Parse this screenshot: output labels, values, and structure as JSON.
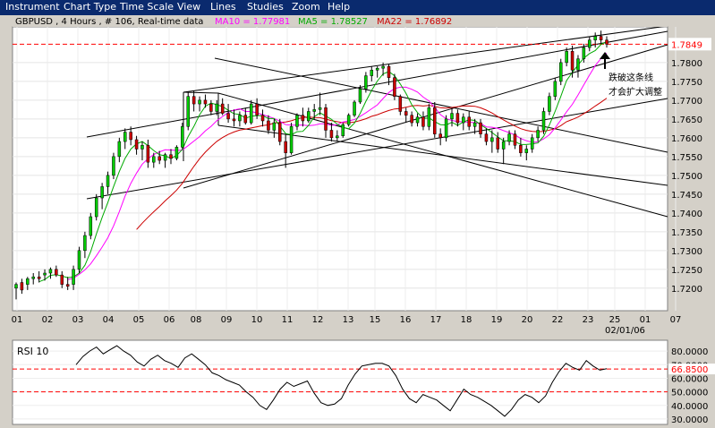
{
  "menu": [
    {
      "label": "Instrument"
    },
    {
      "label": "Chart Type"
    },
    {
      "label": "Time Scale"
    },
    {
      "label": "View"
    },
    {
      "label": "Lines"
    },
    {
      "label": "Studies"
    },
    {
      "label": "Zoom"
    },
    {
      "label": "Help"
    }
  ],
  "header": {
    "instrument_info": "GBPUSD , 4 Hours , # 106, Real-time data",
    "ma10_text": "MA10 = 1.77981",
    "ma5_text": "MA5 = 1.78527",
    "ma22_text": "MA22 = 1.76892"
  },
  "annotation": {
    "line1": "跌破这条线",
    "line2": "才会扩大调整"
  },
  "colors": {
    "background": "#ffffff",
    "frame": "#d4d0c8",
    "menubar": "#0a2a6e",
    "up_candle": "#00cc00",
    "down_candle": "#cc0000",
    "ma10": "#ff00ff",
    "ma5": "#00aa00",
    "ma22": "#cc0000",
    "reference_line": "#ff0000",
    "trend_lines": "#000000",
    "rsi_line": "#000000"
  },
  "chart_data": [
    {
      "type": "candlestick",
      "title": "GBPUSD , 4 Hours , # 106, Real-time data",
      "ylim": [
        1.714,
        1.7895
      ],
      "y_ticks": [
        "1.7200",
        "1.7250",
        "1.7300",
        "1.7350",
        "1.7400",
        "1.7450",
        "1.7500",
        "1.7550",
        "1.7600",
        "1.7650",
        "1.7700",
        "1.7750",
        "1.7800"
      ],
      "x_ticks": [
        "01",
        "02",
        "03",
        "04",
        "05",
        "06",
        "08",
        "09",
        "10",
        "11",
        "12",
        "13",
        "15",
        "16",
        "17",
        "18",
        "19",
        "20",
        "22",
        "23",
        "25",
        "01",
        "07"
      ],
      "date_label": "02/01/06",
      "current_price_label": "1.7849",
      "current_price": 1.7849,
      "grid": true,
      "series": [
        {
          "name": "MA10",
          "value": 1.77981
        },
        {
          "name": "MA5",
          "value": 1.78527
        },
        {
          "name": "MA22",
          "value": 1.76892
        }
      ],
      "candles": [
        [
          1.72,
          1.7215,
          1.717,
          1.721
        ],
        [
          1.7215,
          1.7225,
          1.7185,
          1.7195
        ],
        [
          1.721,
          1.723,
          1.7195,
          1.7225
        ],
        [
          1.7225,
          1.724,
          1.721,
          1.723
        ],
        [
          1.723,
          1.7245,
          1.7215,
          1.7225
        ],
        [
          1.7235,
          1.725,
          1.722,
          1.724
        ],
        [
          1.724,
          1.7255,
          1.7225,
          1.725
        ],
        [
          1.725,
          1.726,
          1.723,
          1.7235
        ],
        [
          1.7235,
          1.7245,
          1.72,
          1.721
        ],
        [
          1.721,
          1.723,
          1.7195,
          1.7205
        ],
        [
          1.721,
          1.726,
          1.7195,
          1.725
        ],
        [
          1.725,
          1.731,
          1.724,
          1.73
        ],
        [
          1.73,
          1.735,
          1.728,
          1.734
        ],
        [
          1.734,
          1.74,
          1.733,
          1.739
        ],
        [
          1.739,
          1.745,
          1.738,
          1.744
        ],
        [
          1.744,
          1.748,
          1.741,
          1.747
        ],
        [
          1.747,
          1.751,
          1.745,
          1.75
        ],
        [
          1.75,
          1.756,
          1.749,
          1.755
        ],
        [
          1.755,
          1.76,
          1.7535,
          1.759
        ],
        [
          1.759,
          1.7625,
          1.757,
          1.7615
        ],
        [
          1.7615,
          1.763,
          1.758,
          1.7595
        ],
        [
          1.7595,
          1.7605,
          1.7555,
          1.757
        ],
        [
          1.757,
          1.759,
          1.754,
          1.758
        ],
        [
          1.758,
          1.7595,
          1.752,
          1.7535
        ],
        [
          1.7535,
          1.756,
          1.752,
          1.755
        ],
        [
          1.755,
          1.7565,
          1.753,
          1.754
        ],
        [
          1.754,
          1.756,
          1.752,
          1.7555
        ],
        [
          1.7555,
          1.757,
          1.753,
          1.7545
        ],
        [
          1.7545,
          1.758,
          1.754,
          1.7575
        ],
        [
          1.7575,
          1.764,
          1.757,
          1.763
        ],
        [
          1.763,
          1.772,
          1.762,
          1.771
        ],
        [
          1.771,
          1.7725,
          1.767,
          1.769
        ],
        [
          1.769,
          1.771,
          1.767,
          1.77
        ],
        [
          1.77,
          1.7715,
          1.768,
          1.769
        ],
        [
          1.769,
          1.77,
          1.766,
          1.767
        ],
        [
          1.767,
          1.77,
          1.766,
          1.769
        ],
        [
          1.769,
          1.7705,
          1.766,
          1.7665
        ],
        [
          1.7665,
          1.769,
          1.764,
          1.765
        ],
        [
          1.765,
          1.7675,
          1.763,
          1.7645
        ],
        [
          1.7645,
          1.767,
          1.763,
          1.766
        ],
        [
          1.766,
          1.768,
          1.7635,
          1.764
        ],
        [
          1.764,
          1.77,
          1.7635,
          1.769
        ],
        [
          1.769,
          1.7705,
          1.765,
          1.766
        ],
        [
          1.766,
          1.7675,
          1.763,
          1.7645
        ],
        [
          1.7645,
          1.766,
          1.761,
          1.762
        ],
        [
          1.762,
          1.765,
          1.76,
          1.764
        ],
        [
          1.764,
          1.765,
          1.758,
          1.759
        ],
        [
          1.759,
          1.761,
          1.752,
          1.756
        ],
        [
          1.756,
          1.764,
          1.7555,
          1.763
        ],
        [
          1.763,
          1.7665,
          1.762,
          1.766
        ],
        [
          1.766,
          1.768,
          1.763,
          1.7645
        ],
        [
          1.7645,
          1.768,
          1.764,
          1.767
        ],
        [
          1.767,
          1.769,
          1.765,
          1.7675
        ],
        [
          1.7675,
          1.772,
          1.766,
          1.768
        ],
        [
          1.768,
          1.769,
          1.76,
          1.762
        ],
        [
          1.762,
          1.764,
          1.759,
          1.76
        ],
        [
          1.76,
          1.762,
          1.759,
          1.7605
        ],
        [
          1.7605,
          1.764,
          1.76,
          1.7635
        ],
        [
          1.7635,
          1.7665,
          1.763,
          1.766
        ],
        [
          1.766,
          1.77,
          1.7655,
          1.7695
        ],
        [
          1.7695,
          1.774,
          1.769,
          1.773
        ],
        [
          1.773,
          1.7775,
          1.772,
          1.7765
        ],
        [
          1.7765,
          1.779,
          1.775,
          1.778
        ],
        [
          1.778,
          1.779,
          1.776,
          1.7785
        ],
        [
          1.7785,
          1.78,
          1.7765,
          1.779
        ],
        [
          1.779,
          1.7795,
          1.774,
          1.776
        ],
        [
          1.776,
          1.777,
          1.77,
          1.771
        ],
        [
          1.771,
          1.7715,
          1.766,
          1.767
        ],
        [
          1.767,
          1.768,
          1.764,
          1.766
        ],
        [
          1.766,
          1.767,
          1.763,
          1.764
        ],
        [
          1.764,
          1.7665,
          1.763,
          1.7655
        ],
        [
          1.7655,
          1.767,
          1.762,
          1.763
        ],
        [
          1.763,
          1.769,
          1.762,
          1.768
        ],
        [
          1.768,
          1.7695,
          1.76,
          1.761
        ],
        [
          1.761,
          1.7625,
          1.758,
          1.76
        ],
        [
          1.76,
          1.766,
          1.759,
          1.765
        ],
        [
          1.765,
          1.768,
          1.763,
          1.7665
        ],
        [
          1.7665,
          1.7675,
          1.763,
          1.764
        ],
        [
          1.764,
          1.7665,
          1.762,
          1.7655
        ],
        [
          1.7655,
          1.767,
          1.762,
          1.763
        ],
        [
          1.763,
          1.765,
          1.761,
          1.764
        ],
        [
          1.764,
          1.765,
          1.76,
          1.761
        ],
        [
          1.761,
          1.7625,
          1.758,
          1.759
        ],
        [
          1.759,
          1.762,
          1.756,
          1.76
        ],
        [
          1.76,
          1.7615,
          1.756,
          1.757
        ],
        [
          1.757,
          1.76,
          1.753,
          1.759
        ],
        [
          1.759,
          1.762,
          1.758,
          1.761
        ],
        [
          1.761,
          1.762,
          1.757,
          1.758
        ],
        [
          1.758,
          1.76,
          1.755,
          1.756
        ],
        [
          1.756,
          1.758,
          1.754,
          1.757
        ],
        [
          1.757,
          1.761,
          1.756,
          1.76
        ],
        [
          1.76,
          1.763,
          1.759,
          1.762
        ],
        [
          1.762,
          1.768,
          1.761,
          1.767
        ],
        [
          1.767,
          1.772,
          1.766,
          1.771
        ],
        [
          1.771,
          1.776,
          1.77,
          1.775
        ],
        [
          1.775,
          1.781,
          1.774,
          1.78
        ],
        [
          1.78,
          1.784,
          1.779,
          1.783
        ],
        [
          1.783,
          1.7845,
          1.776,
          1.778
        ],
        [
          1.778,
          1.782,
          1.776,
          1.781
        ],
        [
          1.781,
          1.785,
          1.78,
          1.784
        ],
        [
          1.784,
          1.787,
          1.783,
          1.786
        ],
        [
          1.786,
          1.788,
          1.784,
          1.787
        ],
        [
          1.787,
          1.7885,
          1.785,
          1.786
        ],
        [
          1.786,
          1.787,
          1.784,
          1.7849
        ]
      ]
    },
    {
      "type": "line",
      "title": "RSI 10",
      "ylim": [
        26,
        88
      ],
      "y_ticks": [
        "30.0000",
        "40.0000",
        "50.0000",
        "60.0000",
        "70.0000",
        "80.0000"
      ],
      "reference_lines": [
        66.85,
        50.0
      ],
      "current_value_label": "66.8500",
      "series": [
        {
          "name": "RSI 10",
          "values": [
            70,
            76,
            80,
            83,
            78,
            81,
            84,
            80,
            77,
            72,
            69,
            74,
            77,
            73,
            71,
            68,
            75,
            78,
            74,
            70,
            64,
            62,
            59,
            57,
            55,
            50,
            46,
            40,
            37,
            44,
            52,
            57,
            54,
            56,
            58,
            49,
            42,
            40,
            41,
            45,
            55,
            63,
            69,
            70,
            71,
            71,
            69,
            62,
            52,
            45,
            42,
            48,
            46,
            44,
            40,
            36,
            44,
            52,
            48,
            46,
            43,
            40,
            36,
            32,
            37,
            44,
            48,
            46,
            42,
            47,
            57,
            65,
            71,
            68,
            66,
            73,
            69,
            66,
            67
          ]
        }
      ]
    }
  ]
}
